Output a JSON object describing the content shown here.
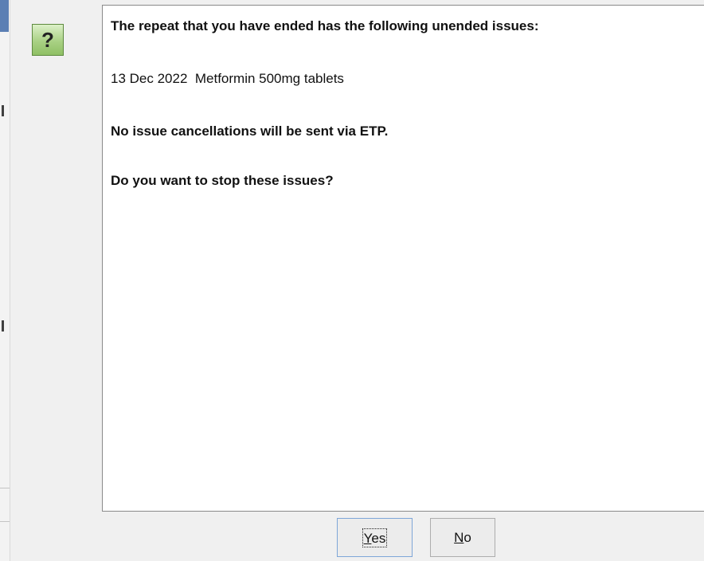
{
  "dialog": {
    "icon": "question-mark-icon",
    "icon_glyph": "?",
    "message": {
      "heading": "The repeat that you have ended has the following unended issues:",
      "issue_line": "13 Dec 2022  Metformin 500mg tablets",
      "etp_notice": "No issue cancellations will be sent via ETP.",
      "question": "Do you want to stop these issues?"
    },
    "buttons": {
      "yes_label": "Yes",
      "no_label": "No"
    }
  },
  "colors": {
    "icon_green": "#a9d184",
    "panel_background": "#ffffff",
    "window_background": "#f0f0f0",
    "left_edge_blue": "#5b7fb4"
  }
}
